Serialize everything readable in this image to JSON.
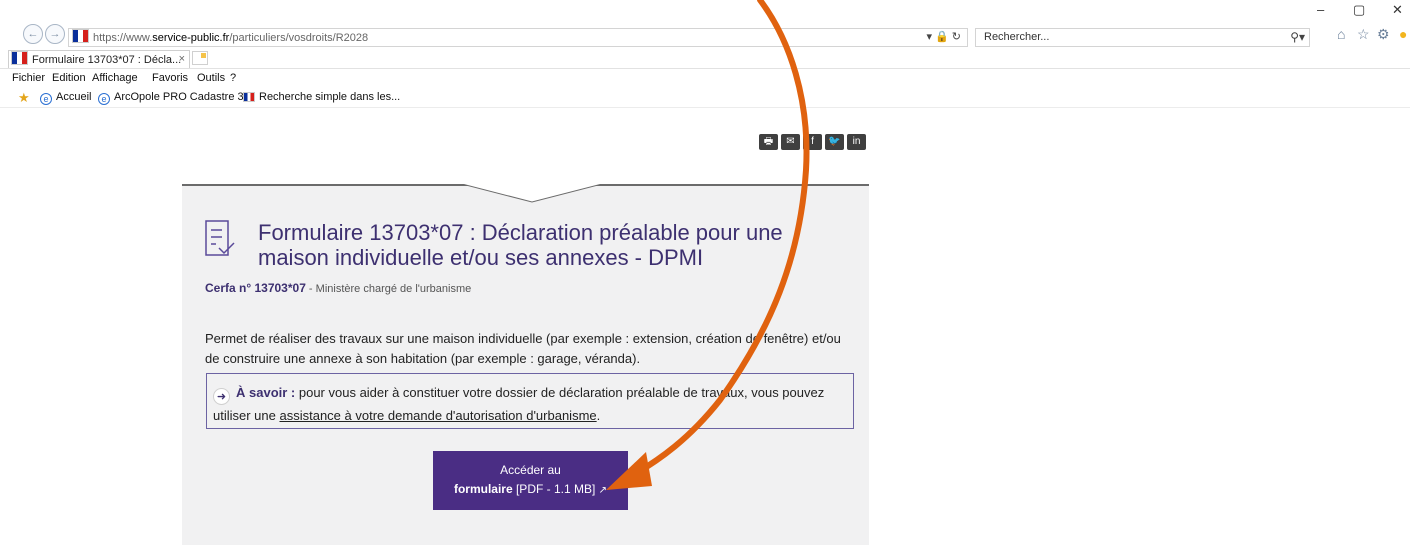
{
  "browser": {
    "url_prefix": "https://www.",
    "url_domain": "service-public.fr",
    "url_path": "/particuliers/vosdroits/R2028",
    "url_icons": "▾ 🔒 ↻",
    "search_placeholder": "Rechercher...",
    "tab_title": "Formulaire 13703*07 : Décla...",
    "tab_close": "×",
    "win_min": "–",
    "win_max": "▢",
    "win_close": "✕",
    "icons": [
      "back-icon",
      "forward-icon",
      "lock-icon",
      "refresh-icon",
      "search-icon",
      "home-icon",
      "favorites-star-icon",
      "gear-icon"
    ]
  },
  "menu": {
    "items": [
      "Fichier",
      "Edition",
      "Affichage",
      "Favoris",
      "Outils",
      "?"
    ]
  },
  "favorites": {
    "items": [
      "Accueil",
      "ArcOpole PRO Cadastre 3.3",
      "Recherche simple dans les..."
    ]
  },
  "share": {
    "buttons": [
      "🖶",
      "✉",
      "f",
      "🐦",
      "in"
    ]
  },
  "page": {
    "title": "Formulaire 13703*07 : Déclaration préalable pour une maison individuelle et/ou ses annexes - DPMI",
    "cerfa_label": "Cerfa n° 13703*07",
    "cerfa_sep": " - ",
    "ministry": "Ministère chargé de l'urbanisme",
    "description": "Permet de réaliser des travaux sur une maison individuelle (par exemple : extension, création de fenêtre) et/ou de construire une annexe à son habitation (par exemple : garage, véranda).",
    "savoir_label": "À savoir :",
    "savoir_text": " pour vous aider à constituer votre dossier de déclaration préalable de travaux, vous pouvez utiliser une ",
    "savoir_link": "assistance à votre demande d'autorisation d'urbanisme",
    "savoir_end": ".",
    "cta_line1": "Accéder au",
    "cta_bold": "formulaire",
    "cta_meta": " [PDF - 1.1 MB] ",
    "cta_icon": "↗"
  },
  "colors": {
    "accent": "#4a2d84",
    "title": "#3d3070",
    "annotation_arrow": "#e0620f"
  }
}
